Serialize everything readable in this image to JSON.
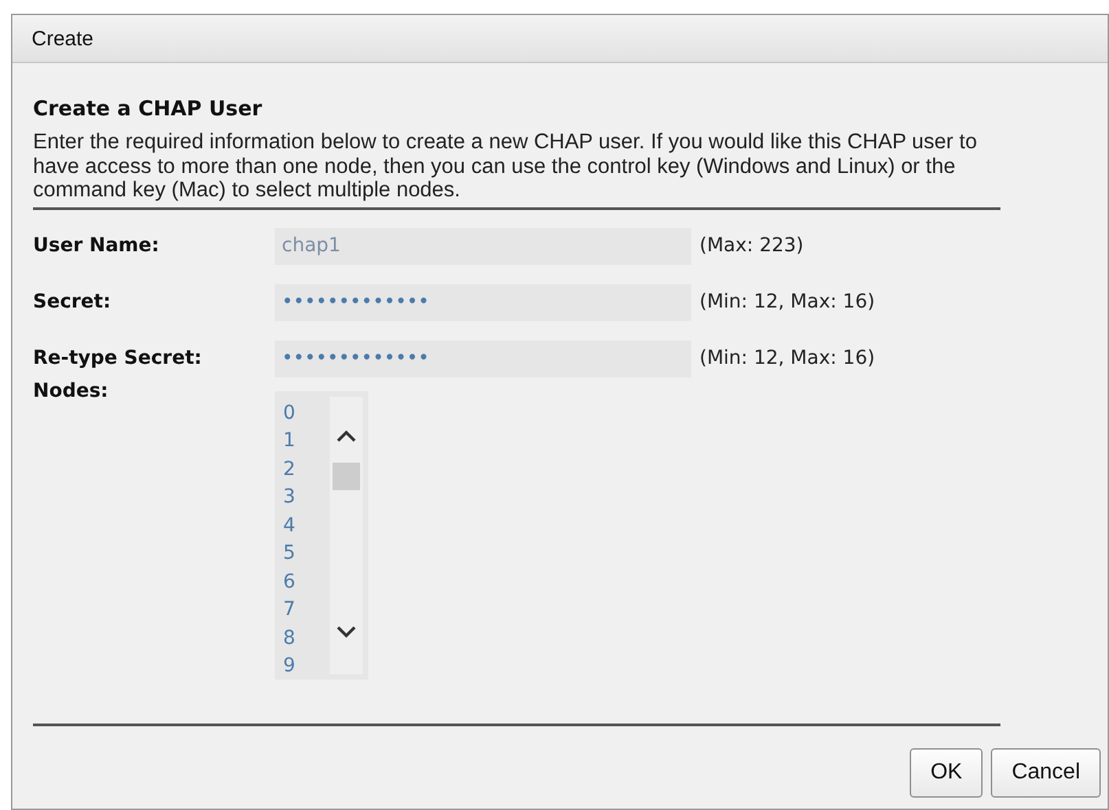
{
  "window": {
    "title": "Create"
  },
  "heading": "Create a CHAP User",
  "description": "Enter the required information below to create a new CHAP user. If you would like this CHAP user to have access to more than one node, then you can use the control key (Windows and Linux) or the command key (Mac) to select multiple nodes.",
  "fields": [
    {
      "label": "User Name:",
      "value": "chap1",
      "hint": "(Max: 223)"
    },
    {
      "label": "Secret:",
      "value": "•••••••••••••",
      "hint": "(Min: 12, Max: 16)"
    },
    {
      "label": "Re-type Secret:",
      "value": "•••••••••••••",
      "hint": "(Min: 12, Max: 16)"
    }
  ],
  "nodes": {
    "label": "Nodes:",
    "items": [
      {
        "label": "0",
        "selected": false
      },
      {
        "label": "1",
        "selected": false
      },
      {
        "label": "2",
        "selected": false
      },
      {
        "label": "3",
        "selected": false
      },
      {
        "label": "4",
        "selected": false
      },
      {
        "label": "5",
        "selected": false
      },
      {
        "label": "6",
        "selected": false
      },
      {
        "label": "7",
        "selected": false
      },
      {
        "label": "8",
        "selected": false
      },
      {
        "label": "9",
        "selected": false
      }
    ]
  },
  "buttons": [
    "OK",
    "Cancel"
  ]
}
